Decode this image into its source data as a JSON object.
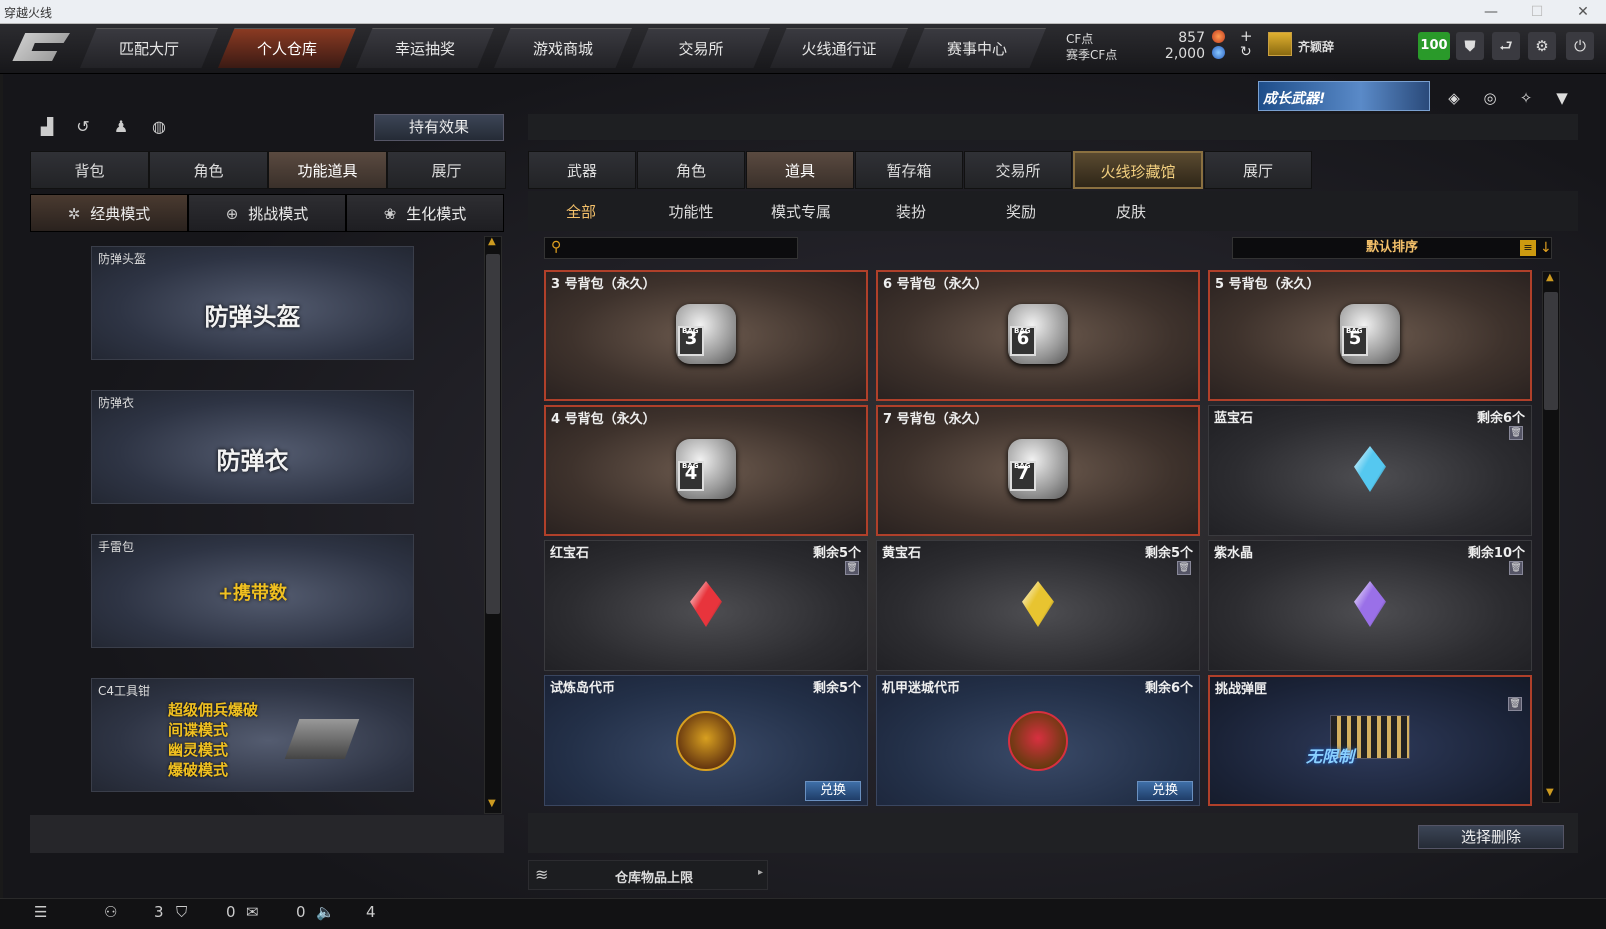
{
  "window": {
    "title": "穿越火线"
  },
  "nav": {
    "tabs": [
      "匹配大厅",
      "个人仓库",
      "幸运抽奖",
      "游戏商城",
      "交易所",
      "火线通行证",
      "赛事中心"
    ],
    "active_index": 1
  },
  "currency": {
    "cf_label": "CF点",
    "cf_value": "857",
    "season_label": "赛季CF点",
    "season_value": "2,000",
    "rank_name": "齐颖辞",
    "level": "100"
  },
  "banner": {
    "text": "成长武器!"
  },
  "left": {
    "hold_effect_label": "持有效果",
    "tabs": [
      "背包",
      "角色",
      "功能道具",
      "展厅"
    ],
    "active_tab": 2,
    "modes": [
      "经典模式",
      "挑战模式",
      "生化模式"
    ],
    "active_mode": 0,
    "items": [
      {
        "label": "防弹头盔",
        "big": "防弹头盔"
      },
      {
        "label": "防弹衣",
        "big": "防弹衣"
      },
      {
        "label": "手雷包",
        "big": "+携带数"
      },
      {
        "label": "C4工具钳",
        "lines": [
          "超级佣兵爆破",
          "间谍模式",
          "幽灵模式",
          "爆破模式"
        ]
      }
    ]
  },
  "right": {
    "tabs": [
      "武器",
      "角色",
      "道具",
      "暂存箱",
      "交易所",
      "火线珍藏馆",
      "展厅"
    ],
    "active_tab": 2,
    "highlight_tab": 5,
    "subtabs": [
      "全部",
      "功能性",
      "模式专属",
      "装扮",
      "奖励",
      "皮肤"
    ],
    "active_subtab": 0,
    "search_placeholder": "",
    "sort_label": "默认排序",
    "cards": [
      {
        "type": "bag",
        "name": "3 号背包（永久）",
        "bag_num": "3"
      },
      {
        "type": "bag",
        "name": "6 号背包（永久）",
        "bag_num": "6"
      },
      {
        "type": "bag",
        "name": "5 号背包（永久）",
        "bag_num": "5"
      },
      {
        "type": "bag",
        "name": "4 号背包（永久）",
        "bag_num": "4"
      },
      {
        "type": "bag",
        "name": "7 号背包（永久）",
        "bag_num": "7"
      },
      {
        "type": "gem",
        "name": "蓝宝石",
        "count": "剩余6个",
        "color": "#55c8f0"
      },
      {
        "type": "gem",
        "name": "红宝石",
        "count": "剩余5个",
        "color": "#e8343c"
      },
      {
        "type": "gem",
        "name": "黄宝石",
        "count": "剩余5个",
        "color": "#e8c430"
      },
      {
        "type": "gem",
        "name": "紫水晶",
        "count": "剩余10个",
        "color": "#9a70e8"
      },
      {
        "type": "coin",
        "name": "试炼岛代币",
        "count": "剩余5个",
        "button": "兑换",
        "color": "#d8a020"
      },
      {
        "type": "coin",
        "name": "机甲迷城代币",
        "count": "剩余6个",
        "button": "兑换",
        "color": "#d83040"
      },
      {
        "type": "ammo",
        "name": "挑战弹匣",
        "overlay": "无限制"
      }
    ],
    "storage_label": "仓库物品上限",
    "select_delete_label": "选择删除"
  },
  "bottom": {
    "counts": [
      "3",
      "0",
      "0",
      "4"
    ]
  }
}
